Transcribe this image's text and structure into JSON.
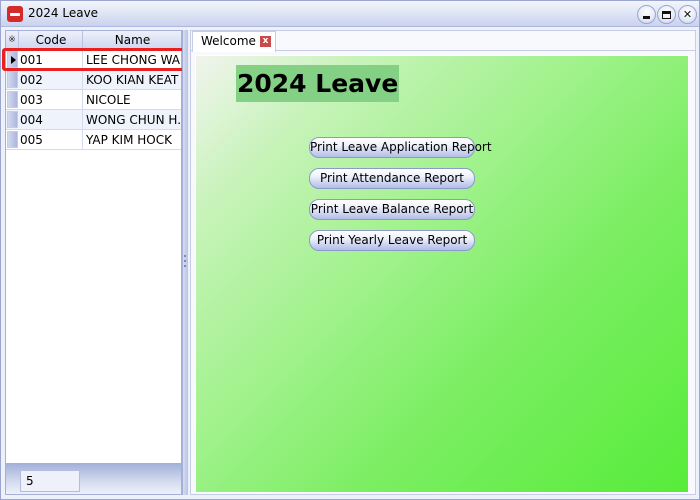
{
  "window": {
    "title": "2024 Leave"
  },
  "employee_grid": {
    "columns": [
      "Code",
      "Name"
    ],
    "header_marker": "※",
    "rows": [
      {
        "code": "001",
        "name": "LEE CHONG WAI",
        "selected": true
      },
      {
        "code": "002",
        "name": "KOO KIAN KEAT",
        "selected": false
      },
      {
        "code": "003",
        "name": "NICOLE",
        "selected": false
      },
      {
        "code": "004",
        "name": "WONG CHUN H...",
        "selected": false
      },
      {
        "code": "005",
        "name": "YAP KIM HOCK",
        "selected": false
      }
    ],
    "record_count": "5"
  },
  "tabs": [
    {
      "label": "Welcome",
      "close_glyph": "x",
      "active": true
    }
  ],
  "welcome": {
    "title": "2024 Leave",
    "buttons": [
      {
        "label": "Print Leave Application Report"
      },
      {
        "label": "Print Attendance Report"
      },
      {
        "label": "Print Leave Balance Report"
      },
      {
        "label": "Print Yearly Leave Report"
      }
    ]
  },
  "colors": {
    "selection_outline": "#e82020",
    "title_highlight": "#84d084",
    "content_gradient_start": "#f1f4ee",
    "content_gradient_end": "#57ec3a"
  }
}
